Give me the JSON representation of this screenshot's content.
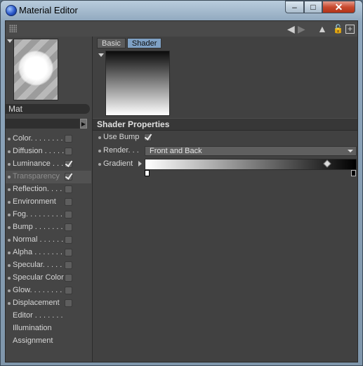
{
  "window": {
    "title": "Material Editor",
    "controls": {
      "minimize": "–",
      "maximize": "□",
      "close": "✕"
    }
  },
  "toolbar": {
    "back": "◀",
    "forward": "▶",
    "up": "▲",
    "lock": "🔓",
    "new": "+"
  },
  "material": {
    "name": "Mat",
    "combo_arrow": "▶"
  },
  "channels": [
    {
      "label": "Color. . . . . . . .",
      "has_checkbox": true,
      "checked": false,
      "selected": false,
      "dot": true
    },
    {
      "label": "Diffusion . . . . .",
      "has_checkbox": true,
      "checked": false,
      "selected": false,
      "dot": true
    },
    {
      "label": "Luminance . . . .",
      "has_checkbox": true,
      "checked": true,
      "selected": false,
      "dot": true
    },
    {
      "label": "Transparency",
      "has_checkbox": true,
      "checked": true,
      "selected": true,
      "dot": true
    },
    {
      "label": "Reflection. . . .",
      "has_checkbox": true,
      "checked": false,
      "selected": false,
      "dot": true
    },
    {
      "label": "Environment",
      "has_checkbox": true,
      "checked": false,
      "selected": false,
      "dot": true
    },
    {
      "label": "Fog. . . . . . . . . .",
      "has_checkbox": true,
      "checked": false,
      "selected": false,
      "dot": true
    },
    {
      "label": "Bump . . . . . . .",
      "has_checkbox": true,
      "checked": false,
      "selected": false,
      "dot": true
    },
    {
      "label": "Normal . . . . . .",
      "has_checkbox": true,
      "checked": false,
      "selected": false,
      "dot": true
    },
    {
      "label": "Alpha . . . . . . .",
      "has_checkbox": true,
      "checked": false,
      "selected": false,
      "dot": true
    },
    {
      "label": "Specular. . . . . .",
      "has_checkbox": true,
      "checked": false,
      "selected": false,
      "dot": true
    },
    {
      "label": "Specular Color",
      "has_checkbox": true,
      "checked": false,
      "selected": false,
      "dot": true
    },
    {
      "label": "Glow. . . . . . . . .",
      "has_checkbox": true,
      "checked": false,
      "selected": false,
      "dot": true
    },
    {
      "label": "Displacement",
      "has_checkbox": true,
      "checked": false,
      "selected": false,
      "dot": true
    },
    {
      "label": "Editor . . . . . . .",
      "has_checkbox": false,
      "checked": false,
      "selected": false,
      "dot": false
    },
    {
      "label": "Illumination",
      "has_checkbox": false,
      "checked": false,
      "selected": false,
      "dot": false
    },
    {
      "label": "Assignment",
      "has_checkbox": false,
      "checked": false,
      "selected": false,
      "dot": false
    }
  ],
  "tabs": [
    {
      "label": "Basic",
      "active": false
    },
    {
      "label": "Shader",
      "active": true
    }
  ],
  "shader": {
    "section_title": "Shader Properties",
    "use_bump_label": "Use Bump",
    "use_bump_checked": true,
    "render_label": "Render. . .",
    "render_value": "Front and Back",
    "gradient_label": "Gradient",
    "gradient_start_color": "#ffffff",
    "gradient_end_color": "#000000"
  },
  "colors": {
    "active_tab": "#7fa1c4",
    "panel_bg": "#434343",
    "close_button": "#c84a2f"
  }
}
